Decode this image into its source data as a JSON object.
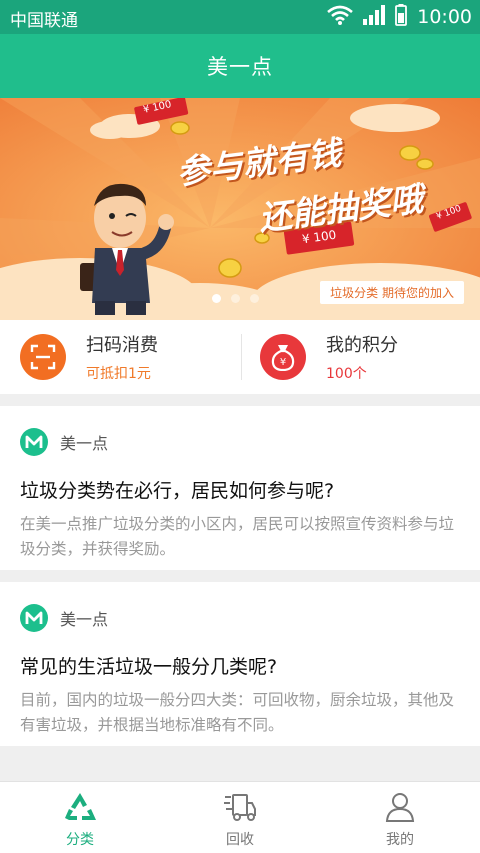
{
  "status_bar": {
    "carrier": "中国联通",
    "time": "10:00"
  },
  "header": {
    "title": "美一点"
  },
  "banner": {
    "headline_1": "参与就有钱",
    "headline_2": "还能抽奖哦",
    "coupon_1": "¥ 100",
    "coupon_2": "¥ 100",
    "coupon_3": "¥ 100",
    "caption": "垃圾分类  期待您的加入",
    "active_slide": 1,
    "slide_count": 3
  },
  "actions": [
    {
      "title": "扫码消费",
      "subtitle": "可抵扣1元",
      "icon": "scan-icon",
      "color": "#f26e22"
    },
    {
      "title": "我的积分",
      "subtitle": "100个",
      "icon": "money-bag-icon",
      "color": "#e8383b"
    }
  ],
  "articles": [
    {
      "source": "美一点",
      "title": "垃圾分类势在必行，居民如何参与呢?",
      "summary": "在美一点推广垃圾分类的小区内，居民可以按照宣传资料参与垃圾分类，并获得奖励。"
    },
    {
      "source": "美一点",
      "title": "常见的生活垃圾一般分几类呢?",
      "summary": "目前，国内的垃圾一般分四大类：可回收物，厨余垃圾，其他及有害垃圾，并根据当地标准略有不同。"
    }
  ],
  "tabbar": [
    {
      "label": "分类",
      "icon": "recycle-icon",
      "active": true
    },
    {
      "label": "回收",
      "icon": "recycle-truck-icon",
      "active": false
    },
    {
      "label": "我的",
      "icon": "user-icon",
      "active": false
    }
  ],
  "colors": {
    "brand": "#20be8c",
    "accent": "#f07a2a",
    "status_bar": "#1ba57c"
  }
}
